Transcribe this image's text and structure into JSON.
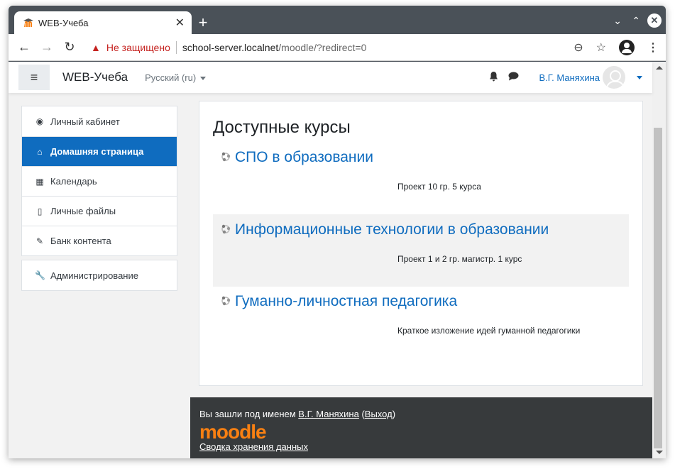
{
  "browser": {
    "tab_title": "WEB-Учеба",
    "tab_close": "✕",
    "new_tab": "+",
    "security_label": "Не защищено",
    "url_host": "school-server.localnet",
    "url_path": "/moodle/?redirect=0",
    "icons": {
      "back": "←",
      "forward": "→",
      "reload": "↻",
      "warning": "▲",
      "zoom": "⊖",
      "star": "☆",
      "menu": "⋮",
      "minimize": "⌄",
      "maximize": "⌃",
      "close": "✕"
    }
  },
  "navbar": {
    "menu_icon": "≡",
    "brand": "WEB-Учеба",
    "language": "Русский (ru)",
    "bell_icon": "🔔",
    "chat_icon": "💬",
    "user_name": "В.Г. Маняхина"
  },
  "sidebar": {
    "groups": [
      {
        "items": [
          {
            "label": "Личный кабинет",
            "icon": "◉",
            "active": false
          },
          {
            "label": "Домашняя страница",
            "icon": "⌂",
            "active": true
          },
          {
            "label": "Календарь",
            "icon": "▦",
            "active": false
          },
          {
            "label": "Личные файлы",
            "icon": "▯",
            "active": false
          },
          {
            "label": "Банк контента",
            "icon": "✎",
            "active": false
          }
        ]
      },
      {
        "items": [
          {
            "label": "Администрирование",
            "icon": "🔧",
            "active": false
          }
        ]
      }
    ]
  },
  "main": {
    "heading": "Доступные курсы",
    "courses": [
      {
        "name": "СПО в образовании",
        "summary": "Проект 10 гр. 5 курса"
      },
      {
        "name": "Информационные технологии в образовании",
        "summary": "Проект 1 и 2 гр. магистр. 1 курс"
      },
      {
        "name": "Гуманно-личностная педагогика",
        "summary": "Краткое изложение идей гуманной педагогики"
      }
    ]
  },
  "footer": {
    "login_prefix": "Вы зашли под именем ",
    "user_link": "В.Г. Маняхина",
    "open_paren": " (",
    "logout_link": "Выход",
    "close_paren": ")",
    "logo": "moodle",
    "policy_link": "Сводка хранения данных"
  },
  "colors": {
    "accent": "#0f6cbf",
    "footer_bg": "#373a3c",
    "moodle_orange": "#f98012",
    "insecure_red": "#c5221f"
  }
}
